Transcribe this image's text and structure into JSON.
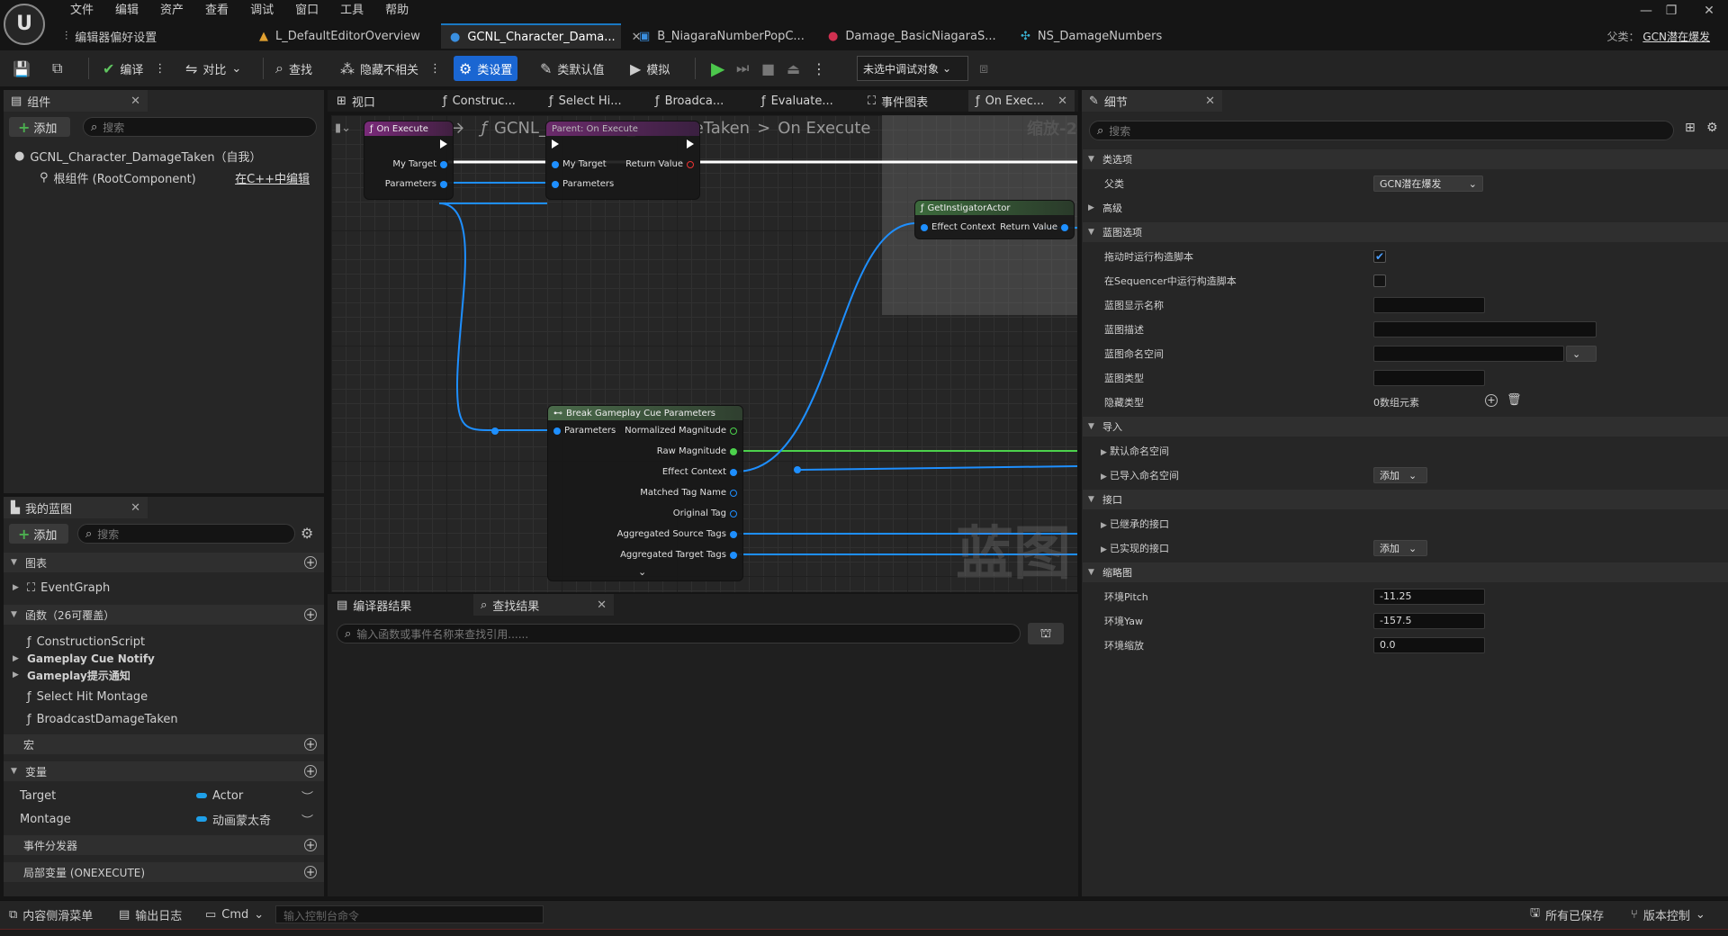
{
  "menu": [
    "文件",
    "编辑",
    "资产",
    "查看",
    "调试",
    "窗口",
    "工具",
    "帮助"
  ],
  "doc_tabs": [
    {
      "label": "编辑器偏好设置",
      "icon": "sliders-icon"
    },
    {
      "label": "L_DefaultEditorOverview",
      "icon": "level-icon"
    },
    {
      "label": "GCNL_Character_Dama...",
      "icon": "blueprint-icon",
      "active": true
    },
    {
      "label": "B_NiagaraNumberPopC...",
      "icon": "blueprint-icon"
    },
    {
      "label": "Damage_BasicNiagaraS...",
      "icon": "niagara-icon"
    },
    {
      "label": "NS_DamageNumbers",
      "icon": "niagara-system-icon"
    }
  ],
  "parent": {
    "label": "父类：",
    "value": "GCN潜在爆发"
  },
  "toolbar": {
    "compile": "编译",
    "diff": "对比",
    "find": "查找",
    "hide_unrelated": "隐藏不相关",
    "class_settings": "类设置",
    "class_defaults": "类默认值",
    "simulate": "模拟",
    "debug_object": "未选中调试对象"
  },
  "components": {
    "tab": "组件",
    "add": "添加",
    "search_placeholder": "搜索",
    "self_item": "GCNL_Character_DamageTaken（自我）",
    "root_item": "根组件 (RootComponent)",
    "edit_cpp": "在C++中编辑"
  },
  "my_blueprint": {
    "tab": "我的蓝图",
    "add": "添加",
    "search_placeholder": "搜索",
    "graphs_section": "图表",
    "event_graph": "EventGraph",
    "functions_section": "函数（26可覆盖）",
    "construction_script": "ConstructionScript",
    "gc_notify": "Gameplay Cue Notify",
    "gc_hint": "Gameplay提示通知",
    "select_hit_montage": "Select Hit Montage",
    "broadcast": "BroadcastDamageTaken",
    "macros_section": "宏",
    "variables_section": "变量",
    "variables": [
      {
        "name": "Target",
        "type": "Actor"
      },
      {
        "name": "Montage",
        "type": "动画蒙太奇"
      }
    ],
    "dispatchers_section": "事件分发器",
    "locals_section": "局部变量 (ONEXECUTE)"
  },
  "graph_tabs": [
    {
      "label": "视口",
      "icon": "viewport-icon"
    },
    {
      "label": "Construc...",
      "icon": "function-icon"
    },
    {
      "label": "Select Hi...",
      "icon": "function-icon"
    },
    {
      "label": "Broadca...",
      "icon": "function-icon"
    },
    {
      "label": "Evaluate...",
      "icon": "function-icon"
    },
    {
      "label": "事件图表",
      "icon": "event-graph-icon"
    },
    {
      "label": "On Exec...",
      "icon": "function-icon",
      "active": true
    }
  ],
  "graph": {
    "breadcrumb_root": "GCNL_Character_DamageTaken",
    "breadcrumb_sep": ">",
    "breadcrumb_leaf": "On Execute",
    "zoom": "缩放-2",
    "watermark": "蓝图",
    "node_entry": {
      "title": "On Execute",
      "pins": [
        "My Target",
        "Parameters"
      ]
    },
    "node_parent": {
      "title": "Parent: On Execute",
      "pins_in": [
        "My Target",
        "Parameters"
      ],
      "pin_out": "Return Value"
    },
    "node_instigator": {
      "title": "GetInstigatorActor",
      "pin_in": "Effect Context",
      "pin_out": "Return Value"
    },
    "node_break": {
      "title": "Break Gameplay Cue Parameters",
      "pin_in": "Parameters",
      "pins_out": [
        "Normalized Magnitude",
        "Raw Magnitude",
        "Effect Context",
        "Matched Tag Name",
        "Original Tag",
        "Aggregated Source Tags",
        "Aggregated Target Tags"
      ]
    }
  },
  "results": {
    "compiler_tab": "编译器结果",
    "find_tab": "查找结果",
    "search_placeholder": "输入函数或事件名称来查找引用......"
  },
  "details": {
    "tab": "细节",
    "search_placeholder": "搜索",
    "class_options": "类选项",
    "parent_label": "父类",
    "parent_value": "GCN潜在爆发",
    "advanced": "高级",
    "bp_options": "蓝图选项",
    "run_construct_on_drag": "拖动时运行构造脚本",
    "run_construct_sequencer": "在Sequencer中运行构造脚本",
    "display_name": "蓝图显示名称",
    "description": "蓝图描述",
    "namespace": "蓝图命名空间",
    "category": "蓝图类型",
    "hide_categories": "隐藏类型",
    "hide_value": "0数组元素",
    "imports": "导入",
    "default_ns": "默认命名空间",
    "imported_ns": "已导入命名空间",
    "add_label": "添加",
    "interfaces": "接口",
    "inherited_if": "已继承的接口",
    "implemented_if": "已实现的接口",
    "thumbnail": "缩略图",
    "env_pitch": "环境Pitch",
    "env_pitch_val": "-11.25",
    "env_yaw": "环境Yaw",
    "env_yaw_val": "-157.5",
    "env_zoom": "环境缩放",
    "env_zoom_val": "0.0"
  },
  "status": {
    "content_drawer": "内容侧滑菜单",
    "output_log": "输出日志",
    "cmd": "Cmd",
    "console_placeholder": "输入控制台命令",
    "all_saved": "所有已保存",
    "source_control": "版本控制"
  }
}
